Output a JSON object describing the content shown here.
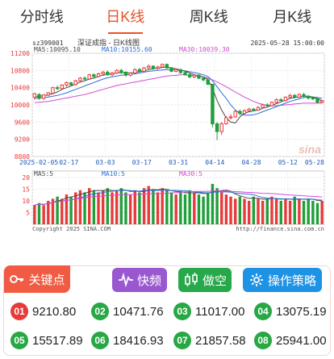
{
  "tabs": [
    {
      "label": "分时线",
      "active": false
    },
    {
      "label": "日K线",
      "active": true
    },
    {
      "label": "周K线",
      "active": false
    },
    {
      "label": "月K线",
      "active": false
    }
  ],
  "chart": {
    "code": "sz399001",
    "name": "深证成指 - 日K线图",
    "datetime": "2025-05-28 15:00:00",
    "ma5": "MA5:10095.10",
    "ma10": "MA10:10155.60",
    "ma30": "MA30:10039.30",
    "yticks": [
      "11200",
      "10800",
      "10400",
      "10000",
      "9600",
      "9200",
      "8800"
    ],
    "xticks": [
      "2025-02-05",
      "02-17",
      "03-03",
      "03-17",
      "03-31",
      "04-14",
      "04-28",
      "05-12",
      "05-28"
    ],
    "vol_ma5": "MA5:5",
    "vol_ma10": "MA10:5",
    "vol_ma30": "MA30:5",
    "vol_yticks": [
      "20",
      "15",
      "10",
      "5"
    ],
    "copyright": "Copyright 2025 SINA.COM",
    "source_url": "http://finance.sina.com.cn",
    "watermark": "sina",
    "colors": {
      "up": "#e83a3a",
      "down": "#1f9f3a",
      "ma5": "#4a4a4a",
      "ma10": "#2a6fd6",
      "ma30": "#d34bd3"
    }
  },
  "chart_data": {
    "type": "candlestick",
    "ylim": [
      8800,
      11200
    ],
    "candles": [
      [
        10180,
        10260,
        10120,
        10280
      ],
      [
        10240,
        10150,
        10120,
        10270
      ],
      [
        10150,
        10230,
        10120,
        10250
      ],
      [
        10230,
        10280,
        10200,
        10300
      ],
      [
        10270,
        10400,
        10250,
        10420
      ],
      [
        10400,
        10380,
        10340,
        10450
      ],
      [
        10380,
        10460,
        10350,
        10480
      ],
      [
        10460,
        10520,
        10420,
        10540
      ],
      [
        10510,
        10470,
        10440,
        10540
      ],
      [
        10470,
        10560,
        10450,
        10580
      ],
      [
        10560,
        10620,
        10520,
        10650
      ],
      [
        10620,
        10600,
        10560,
        10660
      ],
      [
        10600,
        10700,
        10580,
        10720
      ],
      [
        10700,
        10660,
        10620,
        10730
      ],
      [
        10660,
        10720,
        10640,
        10750
      ],
      [
        10720,
        10760,
        10690,
        10790
      ],
      [
        10760,
        10700,
        10680,
        10800
      ],
      [
        10700,
        10740,
        10670,
        10770
      ],
      [
        10740,
        10800,
        10720,
        10830
      ],
      [
        10800,
        10760,
        10720,
        10840
      ],
      [
        10760,
        10690,
        10650,
        10780
      ],
      [
        10690,
        10740,
        10660,
        10760
      ],
      [
        10740,
        10820,
        10720,
        10850
      ],
      [
        10820,
        10780,
        10750,
        10860
      ],
      [
        10780,
        10860,
        10760,
        10880
      ],
      [
        10860,
        10900,
        10830,
        10940
      ],
      [
        10900,
        10850,
        10820,
        10920
      ],
      [
        10850,
        10880,
        10820,
        10910
      ],
      [
        10880,
        10940,
        10860,
        10960
      ],
      [
        10940,
        10860,
        10840,
        10960
      ],
      [
        10860,
        10780,
        10760,
        10880
      ],
      [
        10780,
        10820,
        10760,
        10850
      ],
      [
        10820,
        10750,
        10720,
        10840
      ],
      [
        10750,
        10700,
        10680,
        10780
      ],
      [
        10700,
        10650,
        10620,
        10740
      ],
      [
        10650,
        10690,
        10620,
        10720
      ],
      [
        10690,
        10620,
        10600,
        10710
      ],
      [
        10620,
        10580,
        10550,
        10650
      ],
      [
        10580,
        10480,
        10460,
        10600
      ],
      [
        10480,
        9560,
        9480,
        10480
      ],
      [
        9560,
        9380,
        9180,
        9600
      ],
      [
        9380,
        9560,
        9300,
        9600
      ],
      [
        9560,
        9700,
        9540,
        9740
      ],
      [
        9700,
        9720,
        9660,
        9780
      ],
      [
        9720,
        9850,
        9700,
        9880
      ],
      [
        9850,
        9800,
        9760,
        9890
      ],
      [
        9800,
        9860,
        9780,
        9900
      ],
      [
        9860,
        9900,
        9830,
        9930
      ],
      [
        9900,
        9880,
        9850,
        9930
      ],
      [
        9880,
        9940,
        9860,
        9970
      ],
      [
        9940,
        10000,
        9920,
        10030
      ],
      [
        10000,
        9980,
        9950,
        10040
      ],
      [
        9980,
        10060,
        9960,
        10080
      ],
      [
        10060,
        10120,
        10040,
        10150
      ],
      [
        10120,
        10100,
        10070,
        10160
      ],
      [
        10100,
        10180,
        10080,
        10200
      ],
      [
        10180,
        10220,
        10160,
        10260
      ],
      [
        10220,
        10180,
        10150,
        10250
      ],
      [
        10180,
        10240,
        10160,
        10270
      ],
      [
        10240,
        10200,
        10170,
        10280
      ],
      [
        10200,
        10160,
        10120,
        10230
      ],
      [
        10160,
        10140,
        10110,
        10200
      ],
      [
        10140,
        10060,
        10040,
        10170
      ],
      [
        10060,
        10095,
        10040,
        10120
      ]
    ],
    "ma5": [
      10180,
      10200,
      10210,
      10230,
      10260,
      10300,
      10360,
      10400,
      10440,
      10480,
      10530,
      10560,
      10600,
      10620,
      10660,
      10690,
      10710,
      10720,
      10740,
      10750,
      10750,
      10740,
      10760,
      10770,
      10790,
      10820,
      10840,
      10850,
      10870,
      10880,
      10860,
      10840,
      10810,
      10780,
      10740,
      10700,
      10680,
      10650,
      10590,
      10380,
      10100,
      9880,
      9700,
      9600,
      9580,
      9720,
      9800,
      9840,
      9860,
      9880,
      9920,
      9950,
      9990,
      10030,
      10070,
      10110,
      10150,
      10170,
      10190,
      10200,
      10200,
      10180,
      10150,
      10095
    ],
    "ma10": [
      10150,
      10160,
      10170,
      10180,
      10200,
      10220,
      10250,
      10280,
      10320,
      10360,
      10400,
      10440,
      10480,
      10520,
      10560,
      10600,
      10630,
      10650,
      10670,
      10690,
      10700,
      10710,
      10720,
      10740,
      10760,
      10780,
      10790,
      10800,
      10810,
      10820,
      10820,
      10810,
      10800,
      10790,
      10770,
      10750,
      10730,
      10700,
      10660,
      10560,
      10420,
      10280,
      10150,
      10000,
      9880,
      9800,
      9760,
      9760,
      9770,
      9800,
      9840,
      9880,
      9920,
      9960,
      10000,
      10040,
      10080,
      10110,
      10140,
      10170,
      10180,
      10180,
      10170,
      10155
    ],
    "ma30": [
      10050,
      10060,
      10070,
      10080,
      10100,
      10120,
      10140,
      10160,
      10180,
      10200,
      10220,
      10240,
      10270,
      10300,
      10330,
      10360,
      10390,
      10420,
      10450,
      10470,
      10490,
      10510,
      10530,
      10550,
      10570,
      10590,
      10610,
      10630,
      10650,
      10670,
      10680,
      10690,
      10700,
      10700,
      10690,
      10680,
      10670,
      10650,
      10620,
      10580,
      10530,
      10480,
      10420,
      10360,
      10300,
      10240,
      10180,
      10130,
      10080,
      10040,
      10010,
      9990,
      9980,
      9980,
      9990,
      10000,
      10010,
      10020,
      10030,
      10040,
      10040,
      10040,
      10040,
      10039
    ],
    "volumes": [
      9,
      10,
      9,
      11,
      12,
      13,
      12,
      14,
      13,
      15,
      16,
      15,
      17,
      16,
      15,
      16,
      17,
      15,
      16,
      17,
      15,
      14,
      16,
      15,
      17,
      18,
      16,
      15,
      17,
      16,
      15,
      14,
      15,
      14,
      16,
      15,
      14,
      13,
      15,
      19,
      17,
      15,
      14,
      13,
      12,
      13,
      12,
      11,
      13,
      12,
      11,
      12,
      13,
      12,
      11,
      12,
      11,
      13,
      12,
      11,
      12,
      11,
      10,
      11
    ],
    "ylabel_vol_ylim": [
      0,
      22
    ]
  },
  "keypoints": {
    "key_label": "关键点",
    "fast_label": "快频",
    "short_label": "做空",
    "strategy_label": "操作策略",
    "levels": [
      {
        "index": "01",
        "value": "9210.80",
        "color": "red"
      },
      {
        "index": "02",
        "value": "10471.76",
        "color": "green"
      },
      {
        "index": "03",
        "value": "11017.00",
        "color": "green"
      },
      {
        "index": "04",
        "value": "13075.19",
        "color": "green"
      },
      {
        "index": "05",
        "value": "15517.89",
        "color": "green"
      },
      {
        "index": "06",
        "value": "18416.93",
        "color": "green"
      },
      {
        "index": "07",
        "value": "21857.58",
        "color": "green"
      },
      {
        "index": "08",
        "value": "25941.00",
        "color": "green"
      }
    ]
  }
}
